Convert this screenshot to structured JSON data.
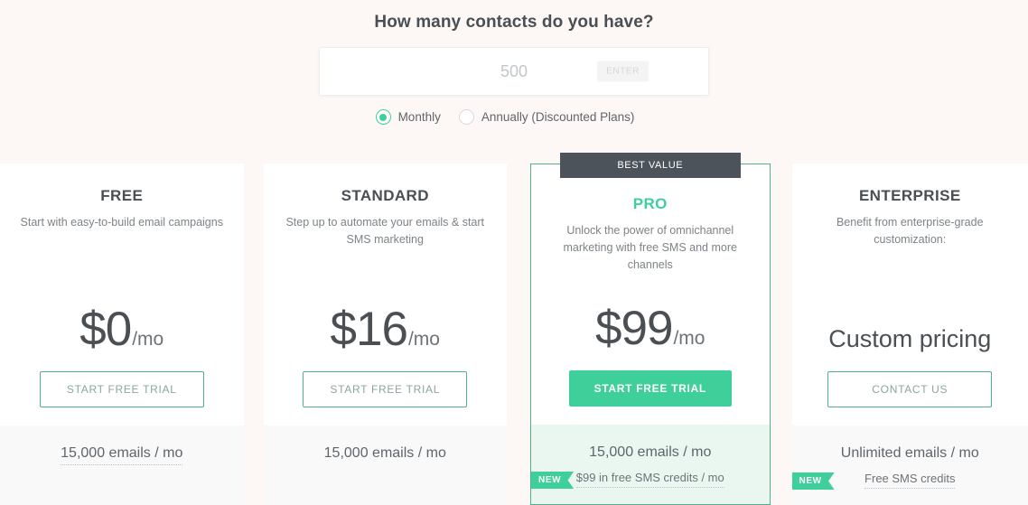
{
  "header": {
    "title": "How many contacts do you have?",
    "input_placeholder": "500",
    "input_value": "",
    "enter_label": "ENTER"
  },
  "billing": {
    "options": [
      {
        "label": "Monthly",
        "selected": true
      },
      {
        "label": "Annually (Discounted Plans)",
        "selected": false
      }
    ]
  },
  "colors": {
    "accent_green": "#3ecf9a",
    "badge_dark": "#4c535a",
    "page_bg": "#fdf8f5",
    "pro_footer_bg": "#eaf7f1"
  },
  "plans": [
    {
      "name": "FREE",
      "description": "Start with easy-to-build email campaigns",
      "price_amount": "$0",
      "price_period": "/mo",
      "cta_label": "START FREE TRIAL",
      "feature_main": "15,000 emails / mo",
      "feature_sub": "",
      "new_badge": ""
    },
    {
      "name": "STANDARD",
      "description": "Step up to automate your emails & start SMS marketing",
      "price_amount": "$16",
      "price_period": "/mo",
      "cta_label": "START FREE TRIAL",
      "feature_main": "15,000 emails / mo",
      "feature_sub": "",
      "new_badge": ""
    },
    {
      "name": "PRO",
      "badge": "BEST VALUE",
      "description": "Unlock the power of omnichannel marketing with free SMS and more channels",
      "price_amount": "$99",
      "price_period": "/mo",
      "cta_label": "START FREE TRIAL",
      "feature_main": "15,000 emails / mo",
      "feature_sub": "$99 in free SMS credits / mo",
      "new_badge": "NEW"
    },
    {
      "name": "ENTERPRISE",
      "description": "Benefit from enterprise-grade customization:",
      "price_custom": "Custom pricing",
      "cta_label": "CONTACT US",
      "feature_main": "Unlimited emails / mo",
      "feature_sub": "Free SMS credits",
      "new_badge": "NEW"
    }
  ]
}
